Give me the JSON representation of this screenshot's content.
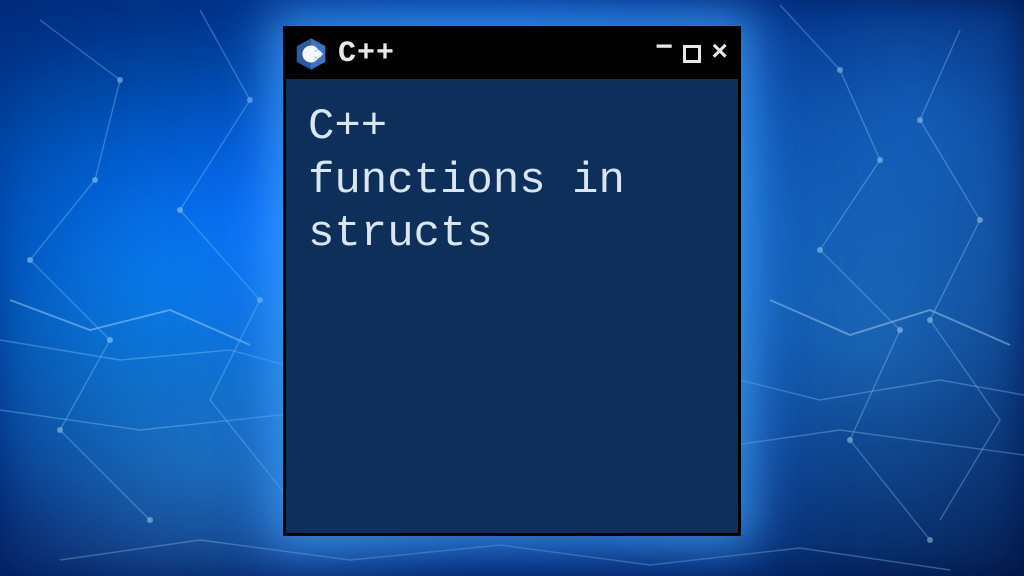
{
  "window": {
    "title": "C++",
    "icon_name": "cpp-icon",
    "controls": {
      "minimize": "−",
      "maximize": "□",
      "close": "×"
    }
  },
  "content": {
    "heading": "C++\nfunctions in\nstructs"
  },
  "colors": {
    "window_bg": "#0d2f5a",
    "titlebar_bg": "#000000",
    "text": "#d9e6f2",
    "glow": "#3fa8ff"
  }
}
